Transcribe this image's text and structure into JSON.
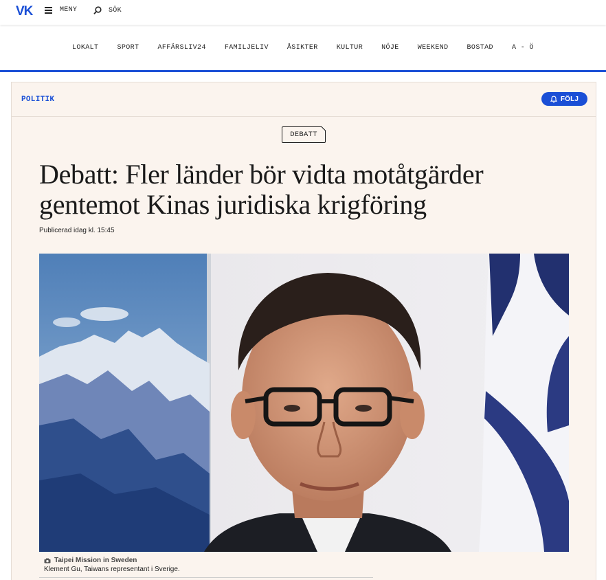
{
  "header": {
    "logo": "VK",
    "menu_label": "MENY",
    "search_label": "SÖK"
  },
  "nav": {
    "items": [
      "LOKALT",
      "SPORT",
      "AFFÄRSLIV24",
      "FAMILJELIV",
      "ÅSIKTER",
      "KULTUR",
      "NÖJE",
      "WEEKEND",
      "BOSTAD",
      "A - Ö"
    ]
  },
  "article": {
    "section": "POLITIK",
    "follow_label": "FÖLJ",
    "category": "DEBATT",
    "headline": "Debatt: Fler länder bör vidta motåtgärder gentemot Kinas juridiska krigföring",
    "published": "Publicerad idag kl. 15:45",
    "image_credit": "Taipei Mission in Sweden",
    "image_caption": "Klement Gu, Taiwans representant i Sverige."
  },
  "colors": {
    "brand_blue": "#1a4fd6",
    "card_bg": "#fbf4ee"
  },
  "icons": {
    "menu": "hamburger-icon",
    "search": "search-icon",
    "follow": "bell-icon",
    "credit": "camera-icon"
  }
}
